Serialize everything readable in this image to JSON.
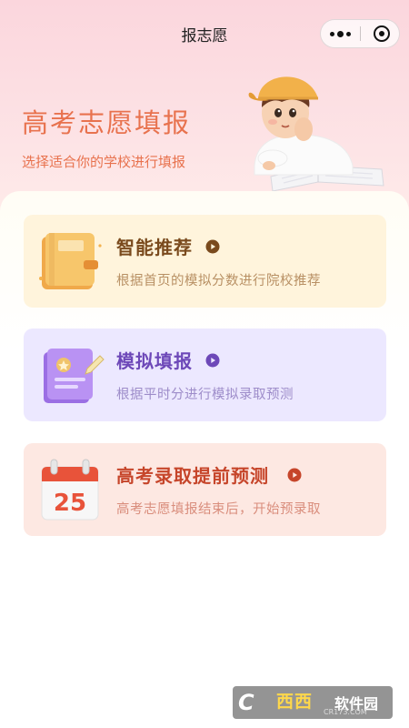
{
  "nav": {
    "title": "报志愿"
  },
  "hero": {
    "title": "高考志愿填报",
    "subtitle": "选择适合你的学校进行填报"
  },
  "cards": [
    {
      "title": "智能推荐",
      "desc": "根据首页的模拟分数进行院校推荐",
      "icon": "notebook-icon",
      "accent": "#7a4a1d"
    },
    {
      "title": "模拟填报",
      "desc": "根据平时分进行模拟录取预测",
      "icon": "certificate-pen-icon",
      "accent": "#6d48b8"
    },
    {
      "title": "高考录取提前预测",
      "desc": "高考志愿填报结束后，开始预录取",
      "icon": "calendar-icon",
      "accent": "#c6452a",
      "calendar_day": "25"
    }
  ],
  "watermark": {
    "logo": "C",
    "name": "西西",
    "site": "软件园",
    "url": "CR173.COM"
  }
}
